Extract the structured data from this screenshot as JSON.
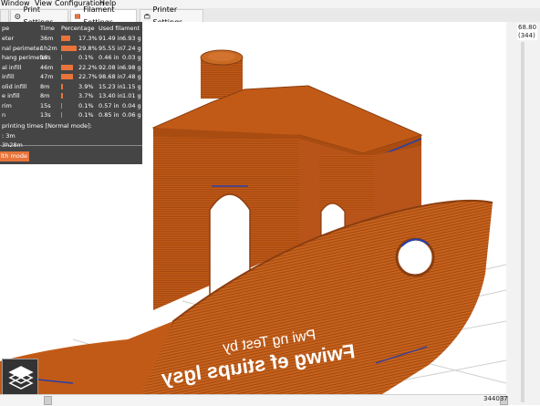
{
  "menubar": {
    "items": [
      "Window",
      "View",
      "Configuration",
      "Help"
    ]
  },
  "tabs": [
    {
      "label": "Print Settings",
      "active": false
    },
    {
      "label": "Filament Settings",
      "active": true
    },
    {
      "label": "Printer Settings",
      "active": false
    }
  ],
  "legend": {
    "headers": [
      "pe",
      "Time",
      "Percentage",
      "Used filament"
    ],
    "rows": [
      {
        "label": "eter",
        "time": "36m",
        "percent": "17.3%",
        "pct": 17.3,
        "length": "91.49 in",
        "weight": "6.93 g"
      },
      {
        "label": "nal perimeter",
        "time": "1h2m",
        "percent": "29.8%",
        "pct": 29.8,
        "length": "95.55 in",
        "weight": "7.24 g"
      },
      {
        "label": "hang perimeter",
        "time": "16s",
        "percent": "0.1%",
        "pct": 0.1,
        "length": "0.46 in",
        "weight": "0.03 g"
      },
      {
        "label": "al infill",
        "time": "46m",
        "percent": "22.2%",
        "pct": 22.2,
        "length": "92.08 in",
        "weight": "6.98 g"
      },
      {
        "label": "infill",
        "time": "47m",
        "percent": "22.7%",
        "pct": 22.7,
        "length": "98.68 in",
        "weight": "7.48 g"
      },
      {
        "label": "olid infill",
        "time": "8m",
        "percent": "3.9%",
        "pct": 3.9,
        "length": "15.23 in",
        "weight": "1.15 g"
      },
      {
        "label": "e infill",
        "time": "8m",
        "percent": "3.7%",
        "pct": 3.7,
        "length": "13.40 in",
        "weight": "1.01 g"
      },
      {
        "label": "rim",
        "time": "15s",
        "percent": "0.1%",
        "pct": 0.1,
        "length": "0.57 in",
        "weight": "0.04 g"
      },
      {
        "label": "n",
        "time": "13s",
        "percent": "0.1%",
        "pct": 0.1,
        "length": "0.85 in",
        "weight": "0.06 g"
      }
    ],
    "times_title": "printing times [Normal mode]:",
    "time_line1": ": 3m",
    "time_line2": "3h28m",
    "stealth_label": "lth mode",
    "accent": "#e8743b"
  },
  "vslider": {
    "top_value": "68.80",
    "top_layer": "(344)"
  },
  "hslider": {
    "value": "344037"
  },
  "model": {
    "body_color": "#c25a17",
    "mirrored_text1": "Fwiwg ef stiups lgsy",
    "mirrored_text2": "Pwi ng Test by"
  }
}
